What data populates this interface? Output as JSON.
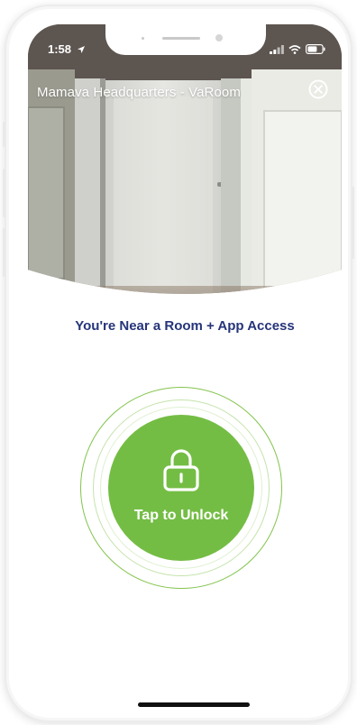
{
  "status_bar": {
    "time": "1:58"
  },
  "header": {
    "room_title": "Mamava Headquarters - VaRoom"
  },
  "main": {
    "proximity_text": "You're Near a Room + App Access",
    "unlock_label": "Tap to Unlock"
  },
  "colors": {
    "accent_green": "#74bd45",
    "ring_green": "#82c44c",
    "navy_text": "#26347a"
  },
  "icons": [
    "location-arrow-icon",
    "signal-icon",
    "wifi-icon",
    "battery-icon",
    "close-circle-icon",
    "padlock-icon"
  ]
}
